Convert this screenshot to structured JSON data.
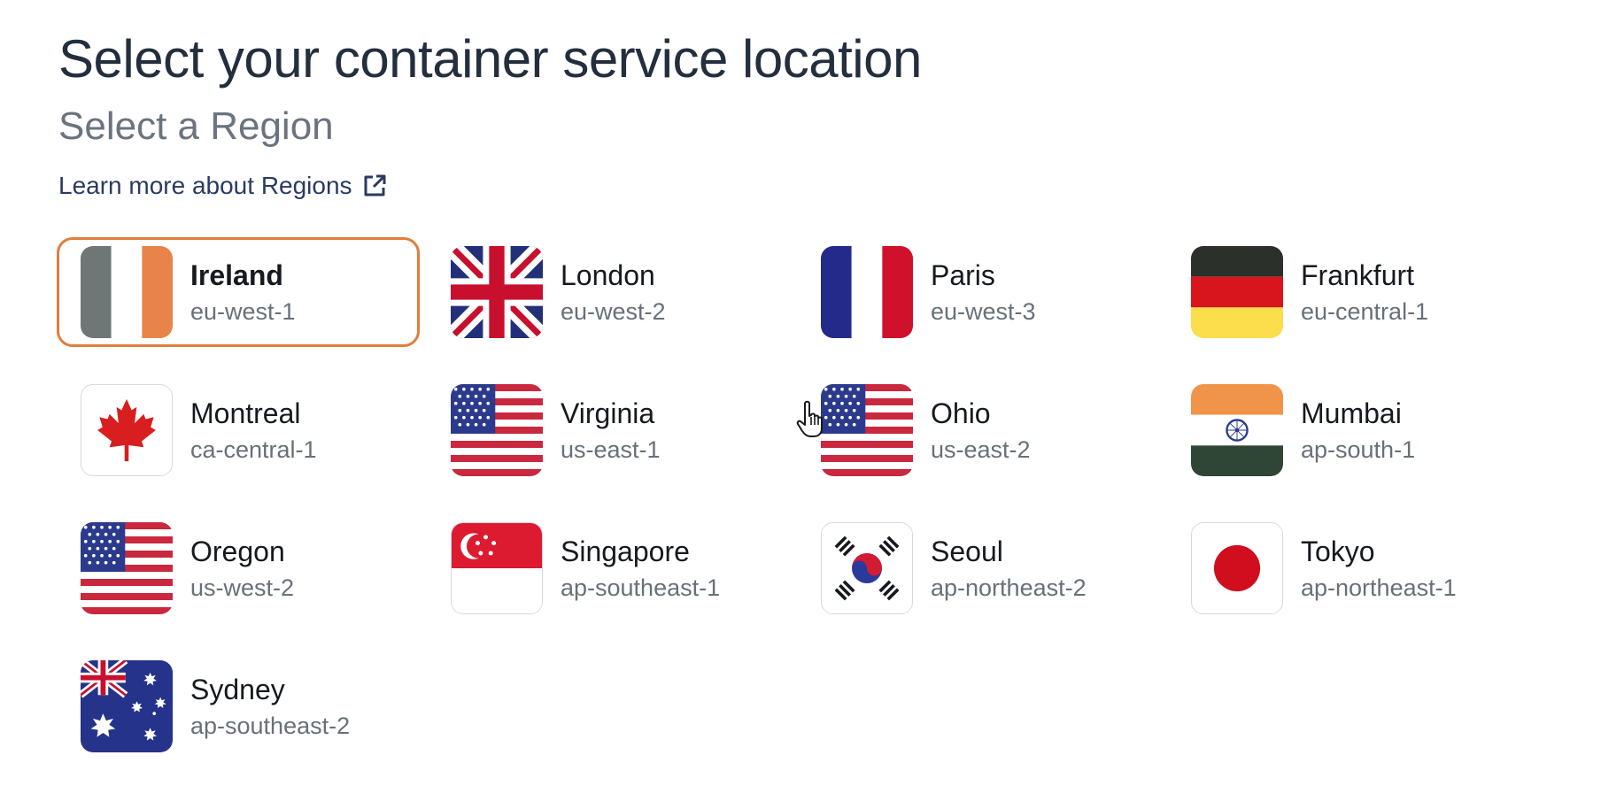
{
  "header": {
    "title": "Select your container service location",
    "subtitle": "Select a Region",
    "learn_more": "Learn more about Regions",
    "learn_more_icon": "external-link-icon"
  },
  "colors": {
    "selected_border": "#e07e3c",
    "link": "#2a3a63"
  },
  "regions": [
    {
      "name": "Ireland",
      "code": "eu-west-1",
      "flag": "ireland-flag-icon",
      "selected": true
    },
    {
      "name": "London",
      "code": "eu-west-2",
      "flag": "uk-flag-icon",
      "selected": false
    },
    {
      "name": "Paris",
      "code": "eu-west-3",
      "flag": "france-flag-icon",
      "selected": false
    },
    {
      "name": "Frankfurt",
      "code": "eu-central-1",
      "flag": "germany-flag-icon",
      "selected": false
    },
    {
      "name": "Montreal",
      "code": "ca-central-1",
      "flag": "canada-flag-icon",
      "selected": false
    },
    {
      "name": "Virginia",
      "code": "us-east-1",
      "flag": "usa-flag-icon",
      "selected": false
    },
    {
      "name": "Ohio",
      "code": "us-east-2",
      "flag": "usa-flag-icon",
      "selected": false
    },
    {
      "name": "Mumbai",
      "code": "ap-south-1",
      "flag": "india-flag-icon",
      "selected": false
    },
    {
      "name": "Oregon",
      "code": "us-west-2",
      "flag": "usa-flag-icon",
      "selected": false
    },
    {
      "name": "Singapore",
      "code": "ap-southeast-1",
      "flag": "singapore-flag-icon",
      "selected": false
    },
    {
      "name": "Seoul",
      "code": "ap-northeast-2",
      "flag": "south-korea-flag-icon",
      "selected": false
    },
    {
      "name": "Tokyo",
      "code": "ap-northeast-1",
      "flag": "japan-flag-icon",
      "selected": false
    },
    {
      "name": "Sydney",
      "code": "ap-southeast-2",
      "flag": "australia-flag-icon",
      "selected": false
    }
  ]
}
